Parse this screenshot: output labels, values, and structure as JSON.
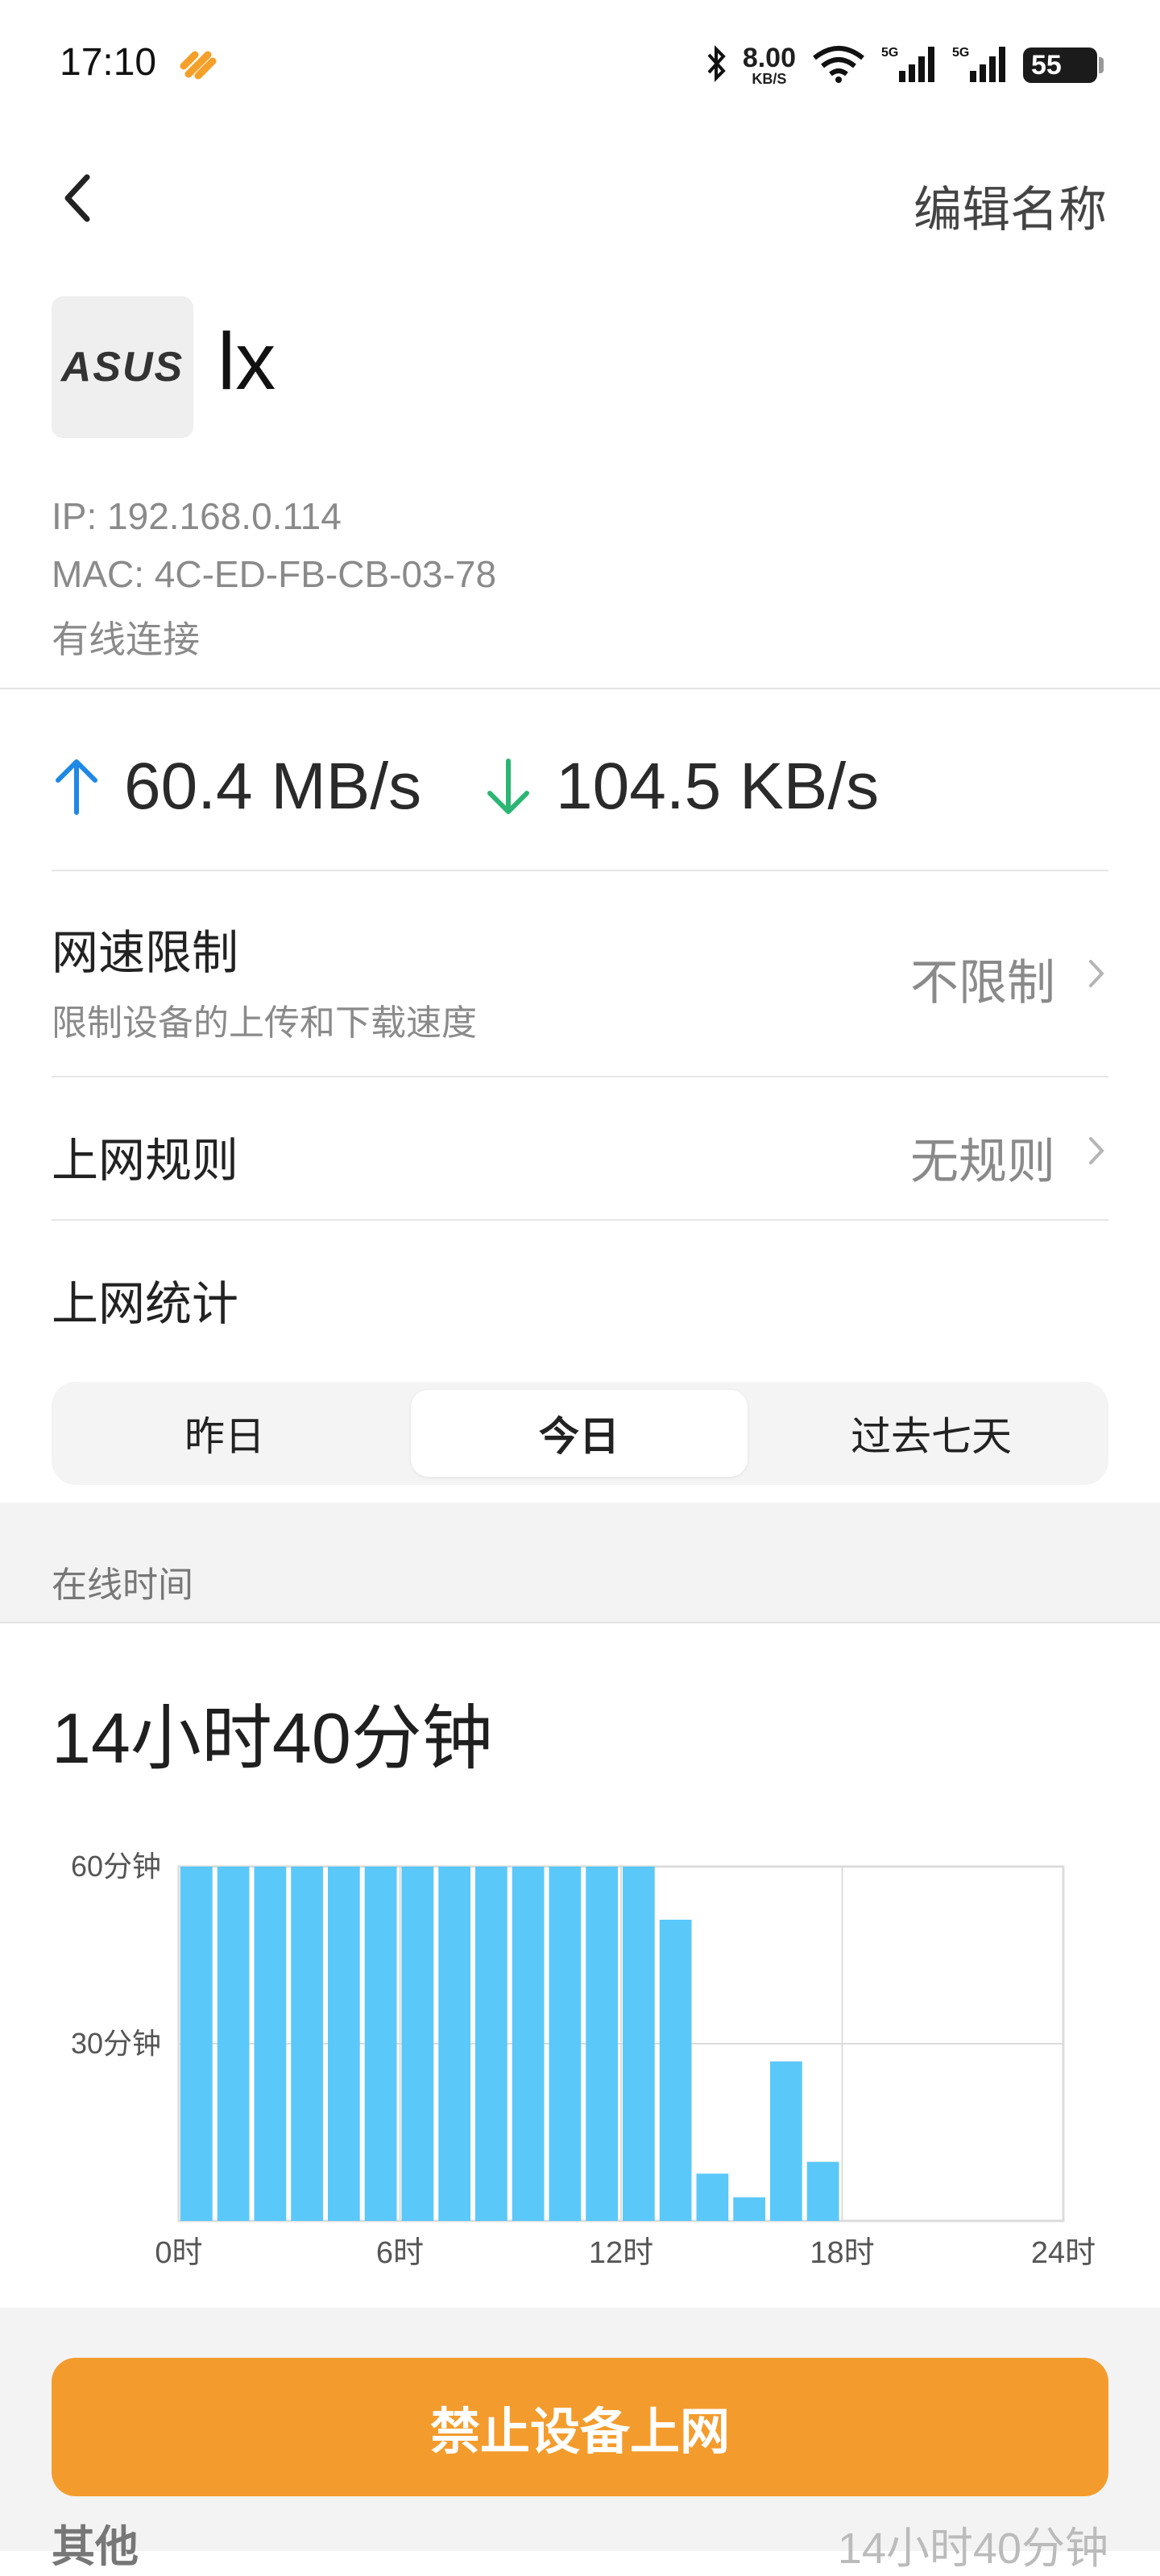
{
  "status_bar": {
    "time": "17:10",
    "net_speed_value": "8.00",
    "net_speed_unit": "KB/S",
    "battery": "55",
    "icons": [
      "app-badge-icon",
      "bluetooth-icon",
      "wifi-icon",
      "signal-5g-icon",
      "signal-5g-icon"
    ]
  },
  "header": {
    "back_icon": "chevron-left-icon",
    "edit_label": "编辑名称"
  },
  "device": {
    "logo_text": "ASUS",
    "name": "lx",
    "ip": "IP: 192.168.0.114",
    "mac": "MAC: 4C-ED-FB-CB-03-78",
    "connection": "有线连接"
  },
  "speed": {
    "upload": "60.4 MB/s",
    "download": "104.5 KB/s",
    "upload_color": "#1e88e5",
    "download_color": "#2bb673"
  },
  "rows": {
    "limit": {
      "title": "网速限制",
      "subtitle": "限制设备的上传和下载速度",
      "value": "不限制"
    },
    "rules": {
      "title": "上网规则",
      "value": "无规则"
    },
    "stats": {
      "title": "上网统计"
    }
  },
  "tabs": [
    {
      "label": "昨日",
      "active": false
    },
    {
      "label": "今日",
      "active": true
    },
    {
      "label": "过去七天",
      "active": false
    }
  ],
  "online": {
    "section_label": "在线时间",
    "total": "14小时40分钟"
  },
  "chart_data": {
    "type": "bar",
    "x": [
      0,
      1,
      2,
      3,
      4,
      5,
      6,
      7,
      8,
      9,
      10,
      11,
      12,
      13,
      14,
      15,
      16,
      17,
      18,
      19,
      20,
      21,
      22,
      23
    ],
    "values": [
      60,
      60,
      60,
      60,
      60,
      60,
      60,
      60,
      60,
      60,
      60,
      60,
      60,
      51,
      8,
      4,
      27,
      10,
      0,
      0,
      0,
      0,
      0,
      0
    ],
    "ylim": [
      0,
      60
    ],
    "xlim": [
      0,
      24
    ],
    "y_ticks": [
      {
        "value": 60,
        "label": "60分钟"
      },
      {
        "value": 30,
        "label": "30分钟"
      }
    ],
    "x_ticks": [
      {
        "value": 0,
        "label": "0时"
      },
      {
        "value": 6,
        "label": "6时"
      },
      {
        "value": 12,
        "label": "12时"
      },
      {
        "value": 18,
        "label": "18时"
      },
      {
        "value": 24,
        "label": "24时"
      }
    ],
    "bar_color": "#5bc8fa",
    "grid": true
  },
  "actions": {
    "block_label": "禁止设备上网",
    "block_color": "#f39c2d"
  },
  "other": {
    "label": "其他",
    "value": "14小时40分钟"
  }
}
